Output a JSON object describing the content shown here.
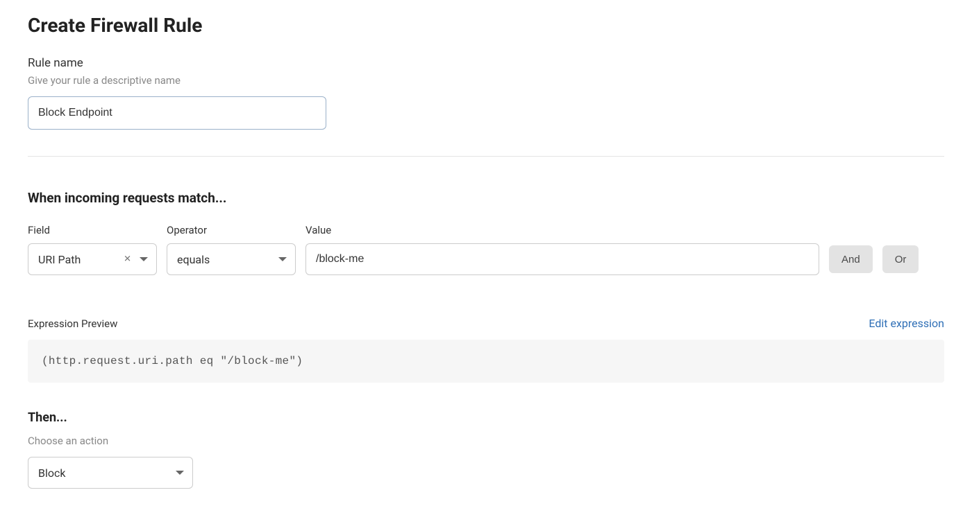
{
  "page_title": "Create Firewall Rule",
  "rule_name_section": {
    "label": "Rule name",
    "hint": "Give your rule a descriptive name",
    "value": "Block Endpoint"
  },
  "match_section": {
    "heading": "When incoming requests match...",
    "columns": {
      "field_label": "Field",
      "operator_label": "Operator",
      "value_label": "Value"
    },
    "row": {
      "field": "URI Path",
      "operator": "equals",
      "value": "/block-me"
    },
    "buttons": {
      "and": "And",
      "or": "Or"
    }
  },
  "preview": {
    "label": "Expression Preview",
    "edit_link": "Edit expression",
    "code": "(http.request.uri.path eq \"/block-me\")"
  },
  "then_section": {
    "heading": "Then...",
    "hint": "Choose an action",
    "action": "Block"
  }
}
